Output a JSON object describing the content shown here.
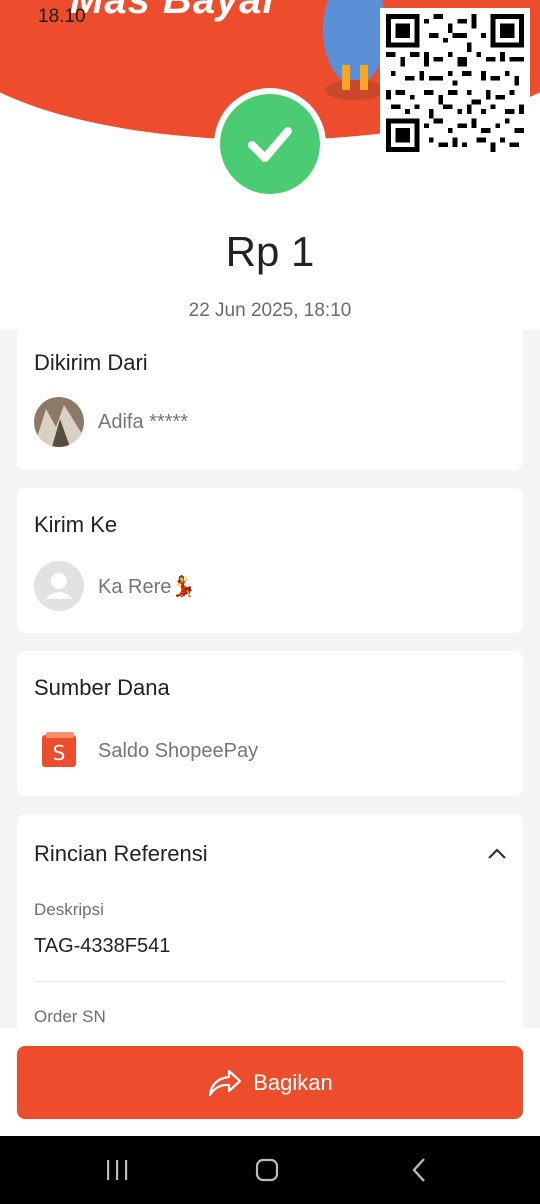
{
  "status_bar": {
    "time": "18.10"
  },
  "header": {
    "promo_text": "Mas Bayar",
    "accent_color": "#ee4d2d",
    "success_color": "#4ccc72"
  },
  "transaction": {
    "amount": "Rp 1",
    "datetime": "22 Jun 2025, 18:10"
  },
  "sender": {
    "title": "Dikirim Dari",
    "name": "Adifa *****"
  },
  "recipient": {
    "title": "Kirim Ke",
    "name": "Ka Rere💃"
  },
  "source": {
    "title": "Sumber Dana",
    "name": "Saldo ShopeePay",
    "icon": "shopee-bag-icon"
  },
  "reference": {
    "title": "Rincian Referensi",
    "description_label": "Deskripsi",
    "description_value": "TAG-4338F541",
    "order_label": "Order SN"
  },
  "actions": {
    "share_label": "Bagikan"
  },
  "navbar": {
    "icons": [
      "recent-apps-icon",
      "home-icon",
      "back-icon"
    ]
  }
}
